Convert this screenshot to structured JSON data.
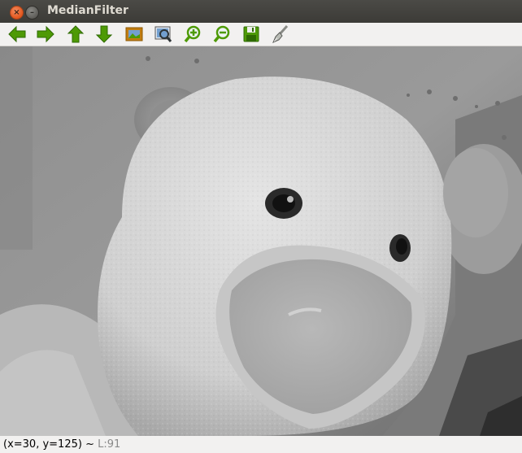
{
  "window": {
    "title": "MedianFilter"
  },
  "window_controls": {
    "close_glyph": "×",
    "minimize_glyph": "–"
  },
  "toolbar": {
    "buttons": [
      {
        "name": "pan-left",
        "icon": "arrow-left-icon"
      },
      {
        "name": "pan-right",
        "icon": "arrow-right-icon"
      },
      {
        "name": "pan-up",
        "icon": "arrow-up-icon"
      },
      {
        "name": "pan-down",
        "icon": "arrow-down-icon"
      },
      {
        "name": "zoom-original",
        "icon": "image-icon"
      },
      {
        "name": "zoom-fit",
        "icon": "zoom-fit-icon"
      },
      {
        "name": "zoom-in",
        "icon": "zoom-in-icon"
      },
      {
        "name": "zoom-out",
        "icon": "zoom-out-icon"
      },
      {
        "name": "save",
        "icon": "save-icon"
      },
      {
        "name": "properties",
        "icon": "brush-icon"
      }
    ]
  },
  "image": {
    "description_icon": "grayscale-teddy-bear-image"
  },
  "status": {
    "coords": "(x=30, y=125) ~ ",
    "level": "L:91"
  },
  "colors": {
    "arrow_green": "#4e9a06",
    "titlebar": "#3c3b37",
    "close": "#e2561d"
  }
}
